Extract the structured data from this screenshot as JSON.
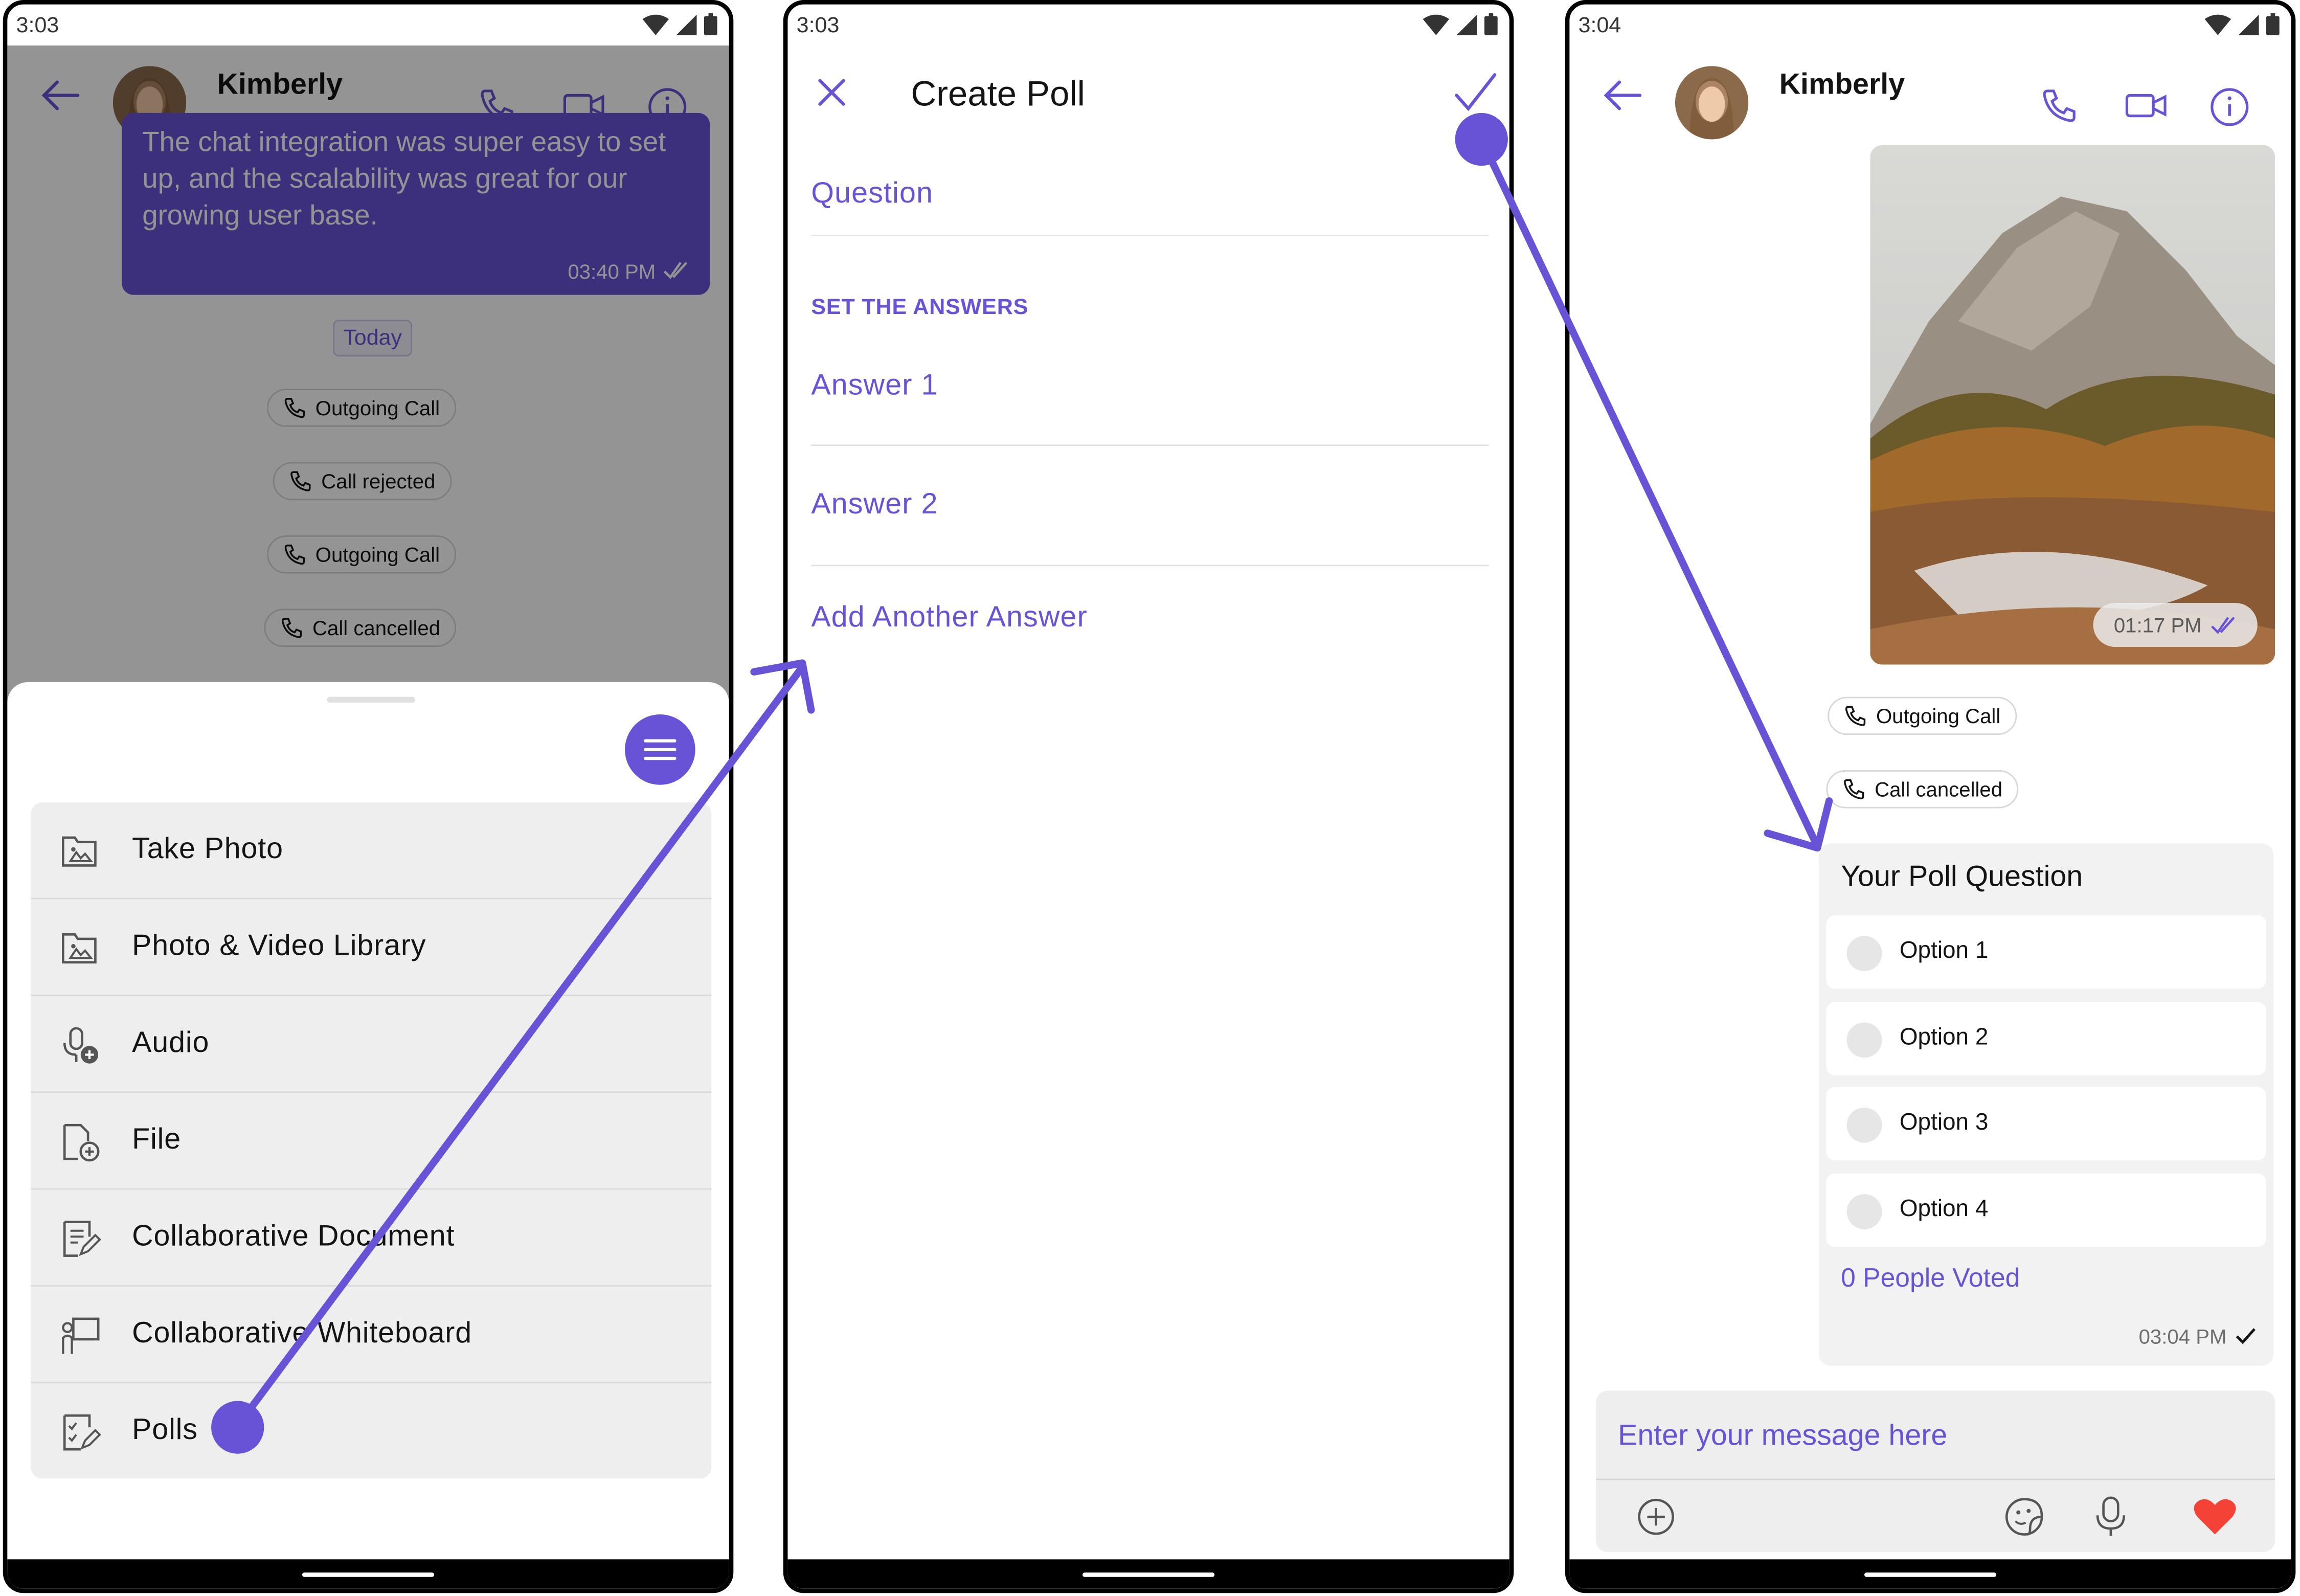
{
  "screen1": {
    "status_time": "3:03",
    "contact_name": "Kimberly",
    "partial_message": "The chat integration was super easy to set up, and the scalability was great for our growing user base.",
    "message_time": "03:40 PM",
    "date_separator": "Today",
    "call_chips": [
      "Outgoing Call",
      "Call rejected",
      "Outgoing Call",
      "Call cancelled"
    ],
    "attachment_menu": [
      {
        "label": "Take Photo",
        "icon": "photo-folder-icon"
      },
      {
        "label": "Photo & Video Library",
        "icon": "photo-folder-icon"
      },
      {
        "label": "Audio",
        "icon": "mic-add-icon"
      },
      {
        "label": "File",
        "icon": "file-add-icon"
      },
      {
        "label": "Collaborative Document",
        "icon": "document-edit-icon"
      },
      {
        "label": "Collaborative Whiteboard",
        "icon": "whiteboard-icon"
      },
      {
        "label": "Polls",
        "icon": "poll-icon"
      }
    ]
  },
  "screen2": {
    "status_time": "3:03",
    "title": "Create Poll",
    "question_placeholder": "Question",
    "answers_section": "SET THE ANSWERS",
    "answer_placeholders": [
      "Answer 1",
      "Answer 2"
    ],
    "add_answer": "Add Another Answer"
  },
  "screen3": {
    "status_time": "3:04",
    "contact_name": "Kimberly",
    "image_time": "01:17 PM",
    "call_chips": [
      "Outgoing Call",
      "Call cancelled"
    ],
    "poll": {
      "question": "Your Poll Question",
      "options": [
        "Option 1",
        "Option 2",
        "Option 3",
        "Option 4"
      ],
      "votes": "0 People Voted",
      "time": "03:04 PM"
    },
    "composer_placeholder": "Enter your message here"
  },
  "colors": {
    "accent": "#6852d6",
    "heart": "#f44336",
    "arrow": "#6852d6"
  }
}
